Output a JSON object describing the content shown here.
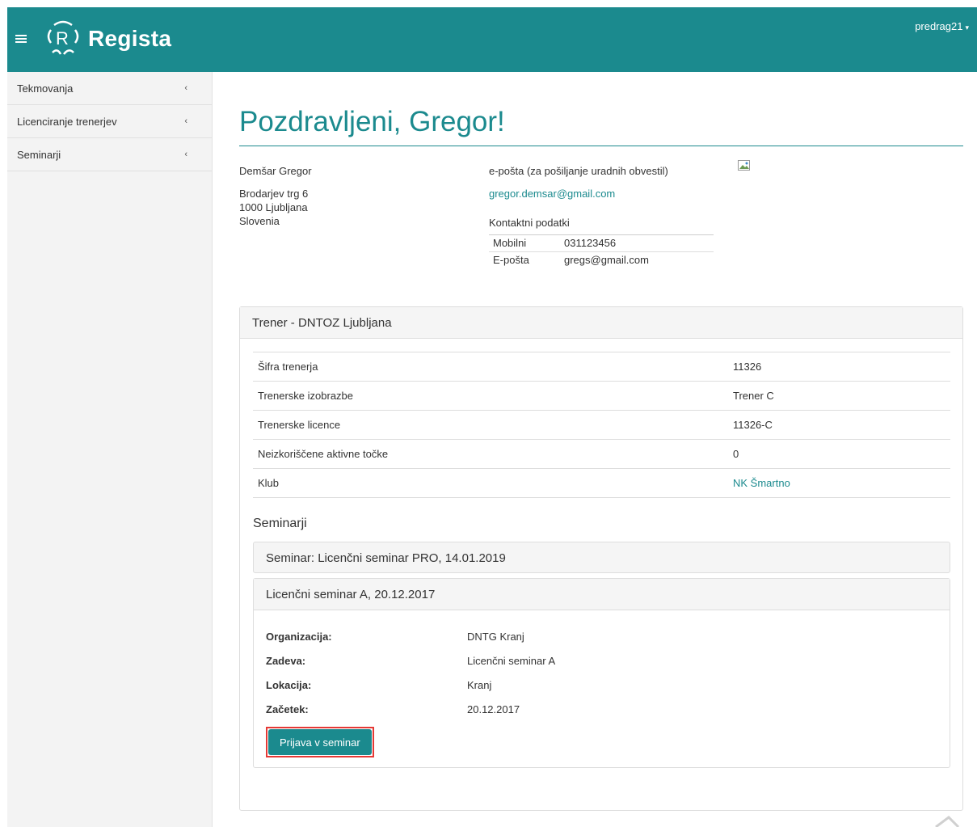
{
  "header": {
    "logo_text": "Regista",
    "user": "predrag21",
    "brand_color": "#1b8a8e"
  },
  "sidebar": {
    "items": [
      {
        "label": "Tekmovanja"
      },
      {
        "label": "Licenciranje trenerjev"
      },
      {
        "label": "Seminarji"
      }
    ]
  },
  "main": {
    "title": "Pozdravljeni, Gregor!",
    "profile": {
      "name": "Demšar Gregor",
      "address_line1": "Brodarjev trg 6",
      "address_line2": "1000 Ljubljana",
      "address_line3": "Slovenia",
      "email_label": "e-pošta (za pošiljanje uradnih obvestil)",
      "email": "gregor.demsar@gmail.com",
      "contact_label": "Kontaktni podatki",
      "contacts": [
        {
          "type": "Mobilni",
          "value": "031123456"
        },
        {
          "type": "E-pošta",
          "value": "gregs@gmail.com"
        }
      ]
    },
    "panel": {
      "heading": "Trener - DNTOZ Ljubljana",
      "rows": [
        {
          "label": "Šifra trenerja",
          "value": "11326"
        },
        {
          "label": "Trenerske izobrazbe",
          "value": "Trener C"
        },
        {
          "label": "Trenerske licence",
          "value": "11326-C"
        },
        {
          "label": "Neizkoriščene aktivne točke",
          "value": "0"
        },
        {
          "label": "Klub",
          "value": "NK Šmartno"
        }
      ],
      "seminars_heading": "Seminarji",
      "seminar_collapsed": "Seminar: Licenčni seminar PRO, 14.01.2019",
      "seminar_open": {
        "title": "Licenčni seminar A, 20.12.2017",
        "details": [
          {
            "key": "Organizacija:",
            "value": "DNTG Kranj"
          },
          {
            "key": "Zadeva:",
            "value": "Licenčni seminar A"
          },
          {
            "key": "Lokacija:",
            "value": "Kranj"
          },
          {
            "key": "Začetek:",
            "value": "20.12.2017"
          }
        ],
        "button_label": "Prijava v seminar"
      }
    }
  }
}
